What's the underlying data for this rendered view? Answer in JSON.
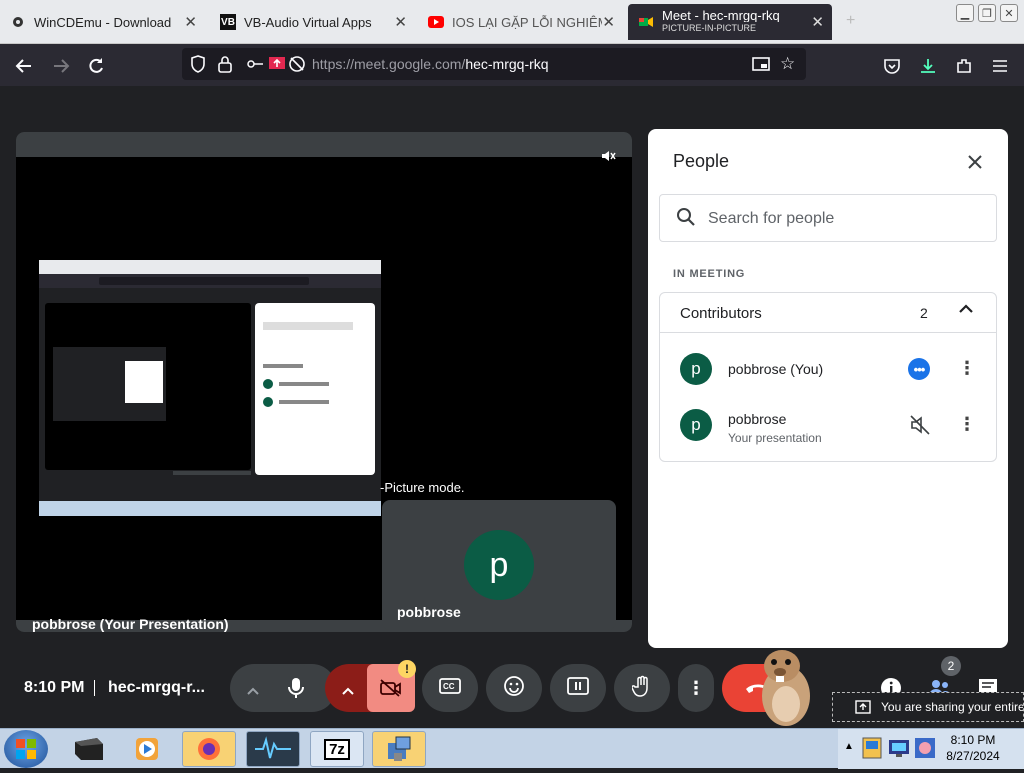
{
  "browser": {
    "tabs": [
      {
        "title": "WinCDEmu - Download",
        "favicon": "gear-icon"
      },
      {
        "title": "VB-Audio Virtual Apps",
        "favicon": "VB"
      },
      {
        "title": "IOS LẠI GẶP LỖI NGHIÊM TR",
        "favicon": "youtube-icon"
      },
      {
        "title": "Meet - hec-mrgq-rkq",
        "subtitle": "PICTURE-IN-PICTURE",
        "favicon": "meet-icon",
        "active": true
      }
    ],
    "url_host": "https://meet.google.com/",
    "url_path": "hec-mrgq-rkq"
  },
  "stage": {
    "presentation_name": "pobbrose (Your Presentation)",
    "pip_text": "-Picture mode.",
    "participant": {
      "initial": "p",
      "name": "pobbrose"
    }
  },
  "people_panel": {
    "title": "People",
    "search_placeholder": "Search for people",
    "section_label": "IN MEETING",
    "group_label": "Contributors",
    "group_count": "2",
    "participants": [
      {
        "initial": "p",
        "name": "pobbrose (You)",
        "subtitle": ""
      },
      {
        "initial": "p",
        "name": "pobbrose",
        "subtitle": "Your presentation"
      }
    ]
  },
  "meeting_bar": {
    "time": "8:10 PM",
    "meeting_code": "hec-mrgq-r...",
    "people_count": "2",
    "share_notice": "You are sharing your entire"
  },
  "taskbar": {
    "time": "8:10 PM",
    "date": "8/27/2024",
    "apps": [
      "start",
      "terminal",
      "media-player",
      "firefox",
      "audio-app",
      "7z",
      "archive-tool"
    ]
  },
  "colors": {
    "meet_bg": "#202124",
    "tile_bg": "#3c4043",
    "avatar_green": "#0b5c45",
    "accent_blue": "#1a73e8",
    "hangup_red": "#ea4335",
    "camera_off_pink": "#f28b82",
    "warn_yellow": "#fdd663"
  }
}
